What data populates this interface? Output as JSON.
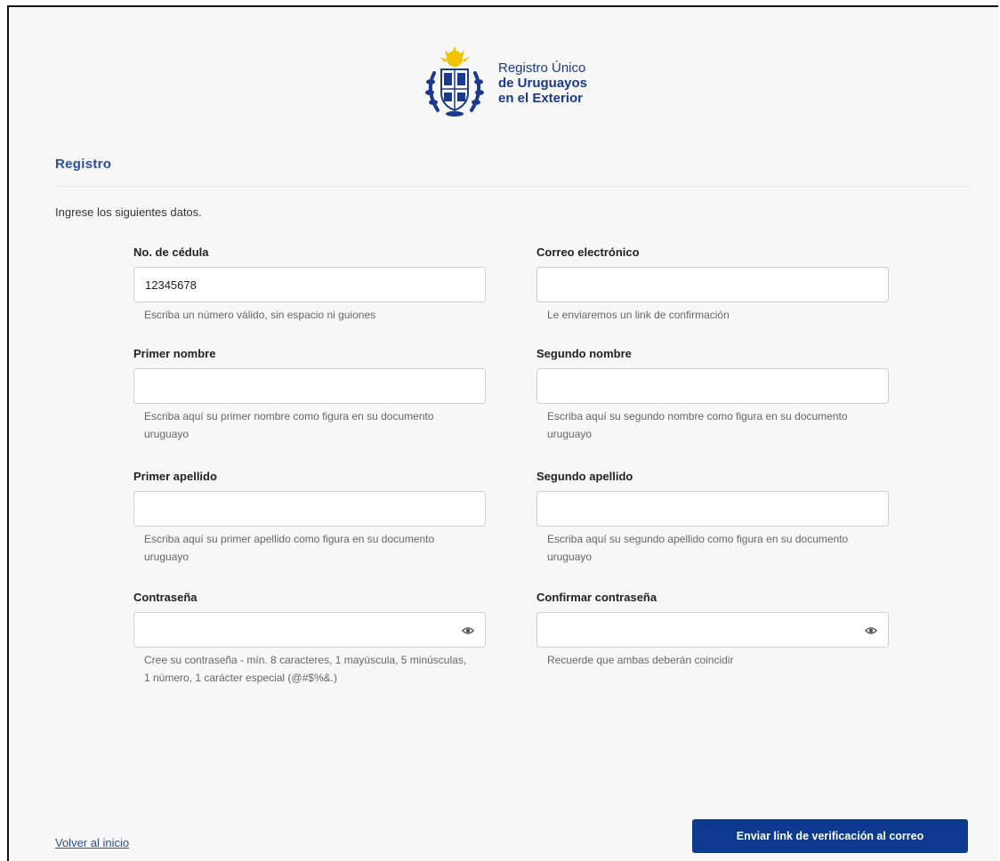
{
  "header": {
    "logo_line1": "Registro Único",
    "logo_line2": "de Uruguayos",
    "logo_line3": "en el Exterior"
  },
  "section": {
    "title": "Registro",
    "intro": "Ingrese los siguientes datos."
  },
  "form": {
    "cedula": {
      "label": "No. de cédula",
      "value": "12345678",
      "help": "Escriba un número válido, sin espacio ni guiones"
    },
    "email": {
      "label": "Correo electrónico",
      "value": "",
      "help": "Le enviaremos un link de confirmación"
    },
    "primer_nombre": {
      "label": "Primer nombre",
      "value": "",
      "help": "Escriba aquí su primer nombre como figura en su documento uruguayo"
    },
    "segundo_nombre": {
      "label": "Segundo nombre",
      "value": "",
      "help": "Escriba aquí su segundo nombre como figura en su documento uruguayo"
    },
    "primer_apellido": {
      "label": "Primer apellido",
      "value": "",
      "help": "Escriba aquí su primer apellido como figura en su documento uruguayo"
    },
    "segundo_apellido": {
      "label": "Segundo apellido",
      "value": "",
      "help": "Escriba aquí su segundo apellido como figura en su documento uruguayo"
    },
    "password": {
      "label": "Contraseña",
      "value": "",
      "help": "Cree su contraseña - mín. 8 caracteres, 1 mayúscula, 5 minúsculas, 1 número, 1 carácter especial (@#$%&.)"
    },
    "confirm_password": {
      "label": "Confirmar contraseña",
      "value": "",
      "help": "Recuerde que ambas deberán coincidir"
    }
  },
  "footer": {
    "back_link": "Volver al inicio",
    "submit_label": "Enviar link de verificación al correo"
  },
  "colors": {
    "primary": "#0d3a8e",
    "title": "#2a4fa0",
    "background": "#f7f7f7"
  },
  "icons": {
    "eye": "eye-icon",
    "emblem": "coat-of-arms-icon"
  }
}
